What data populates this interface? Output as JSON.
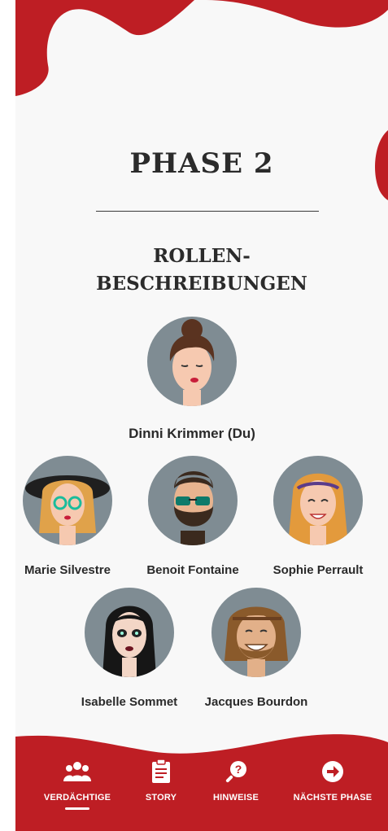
{
  "phase": {
    "title": "PHASE 2"
  },
  "section": {
    "title_line1": "ROLLEN-",
    "title_line2": "BESCHREIBUNGEN"
  },
  "characters": [
    {
      "name": "Dinni Krimmer (Du)",
      "avatar_icon": "woman-hair-bun-avatar"
    },
    {
      "name": "Marie Silvestre",
      "avatar_icon": "woman-hat-glasses-avatar"
    },
    {
      "name": "Benoit Fontaine",
      "avatar_icon": "man-beard-sunglasses-avatar"
    },
    {
      "name": "Sophie Perrault",
      "avatar_icon": "woman-headband-avatar"
    },
    {
      "name": "Isabelle Sommet",
      "avatar_icon": "woman-black-hair-avatar"
    },
    {
      "name": "Jacques Bourdon",
      "avatar_icon": "man-dreadlocks-avatar"
    }
  ],
  "nav": {
    "items": [
      {
        "label": "VERDÄCHTIGE",
        "icon": "users-icon",
        "active": true
      },
      {
        "label": "STORY",
        "icon": "clipboard-icon",
        "active": false
      },
      {
        "label": "HINWEISE",
        "icon": "search-question-icon",
        "active": false
      },
      {
        "label": "NÄCHSTE PHASE",
        "icon": "arrow-circle-right-icon",
        "active": false
      }
    ]
  },
  "colors": {
    "accent": "#be1e24",
    "background": "#f8f8f8",
    "text": "#2b2b2b",
    "avatar_bg": "#7f8c93"
  }
}
